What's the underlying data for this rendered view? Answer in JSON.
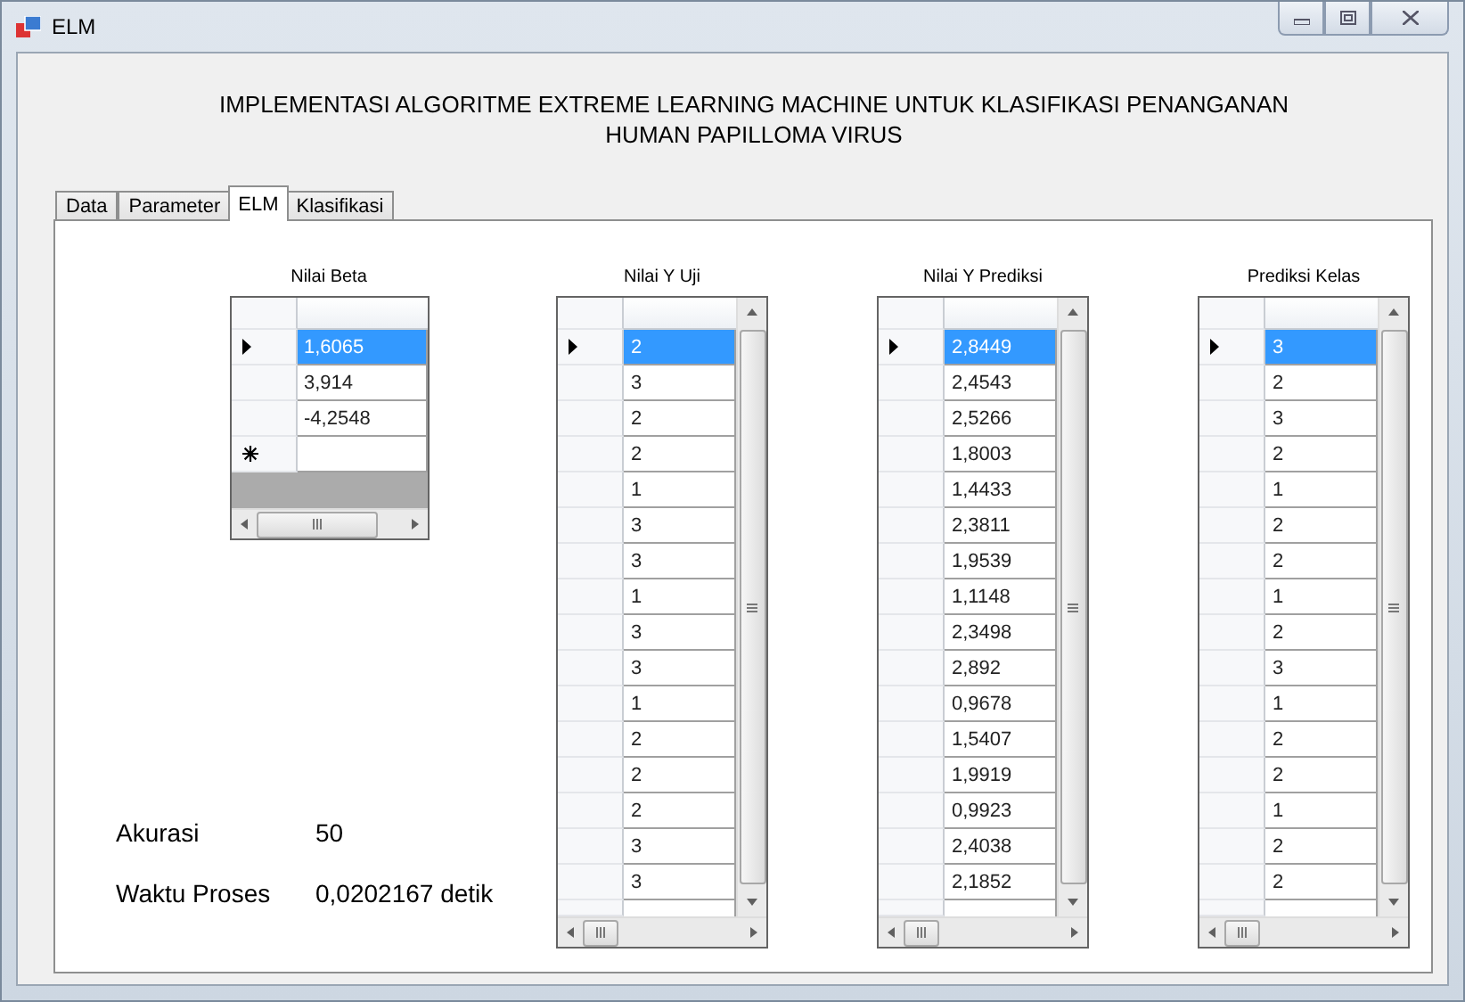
{
  "window": {
    "title": "ELM"
  },
  "heading_lines": [
    "IMPLEMENTASI ALGORITME EXTREME LEARNING MACHINE UNTUK KLASIFIKASI PENANGANAN",
    "HUMAN PAPILLOMA VIRUS"
  ],
  "tabs": [
    {
      "label": "Data",
      "selected": false
    },
    {
      "label": "Parameter",
      "selected": false
    },
    {
      "label": "ELM",
      "selected": true
    },
    {
      "label": "Klasifikasi",
      "selected": false
    }
  ],
  "results": [
    {
      "label": "Akurasi",
      "value": "50"
    },
    {
      "label": "Waktu Proses",
      "value": "0,0202167 detik"
    }
  ],
  "grids": [
    {
      "title": "Nilai Beta",
      "kind": "short",
      "new_row": true,
      "rows": [
        {
          "value": "1,6065",
          "selected": true
        },
        {
          "value": "3,914",
          "selected": false
        },
        {
          "value": "-4,2548",
          "selected": false
        }
      ]
    },
    {
      "title": "Nilai Y Uji",
      "kind": "scroll",
      "rows": [
        {
          "value": "2",
          "selected": true
        },
        {
          "value": "3",
          "selected": false
        },
        {
          "value": "2",
          "selected": false
        },
        {
          "value": "2",
          "selected": false
        },
        {
          "value": "1",
          "selected": false
        },
        {
          "value": "3",
          "selected": false
        },
        {
          "value": "3",
          "selected": false
        },
        {
          "value": "1",
          "selected": false
        },
        {
          "value": "3",
          "selected": false
        },
        {
          "value": "3",
          "selected": false
        },
        {
          "value": "1",
          "selected": false
        },
        {
          "value": "2",
          "selected": false
        },
        {
          "value": "2",
          "selected": false
        },
        {
          "value": "2",
          "selected": false
        },
        {
          "value": "3",
          "selected": false
        },
        {
          "value": "3",
          "selected": false
        }
      ]
    },
    {
      "title": "Nilai Y Prediksi",
      "kind": "scroll",
      "rows": [
        {
          "value": "2,8449",
          "selected": true
        },
        {
          "value": "2,4543",
          "selected": false
        },
        {
          "value": "2,5266",
          "selected": false
        },
        {
          "value": "1,8003",
          "selected": false
        },
        {
          "value": "1,4433",
          "selected": false
        },
        {
          "value": "2,3811",
          "selected": false
        },
        {
          "value": "1,9539",
          "selected": false
        },
        {
          "value": "1,1148",
          "selected": false
        },
        {
          "value": "2,3498",
          "selected": false
        },
        {
          "value": "2,892",
          "selected": false
        },
        {
          "value": "0,9678",
          "selected": false
        },
        {
          "value": "1,5407",
          "selected": false
        },
        {
          "value": "1,9919",
          "selected": false
        },
        {
          "value": "0,9923",
          "selected": false
        },
        {
          "value": "2,4038",
          "selected": false
        },
        {
          "value": "2,1852",
          "selected": false
        }
      ]
    },
    {
      "title": "Prediksi Kelas",
      "kind": "scroll",
      "rows": [
        {
          "value": "3",
          "selected": true
        },
        {
          "value": "2",
          "selected": false
        },
        {
          "value": "3",
          "selected": false
        },
        {
          "value": "2",
          "selected": false
        },
        {
          "value": "1",
          "selected": false
        },
        {
          "value": "2",
          "selected": false
        },
        {
          "value": "2",
          "selected": false
        },
        {
          "value": "1",
          "selected": false
        },
        {
          "value": "2",
          "selected": false
        },
        {
          "value": "3",
          "selected": false
        },
        {
          "value": "1",
          "selected": false
        },
        {
          "value": "2",
          "selected": false
        },
        {
          "value": "2",
          "selected": false
        },
        {
          "value": "1",
          "selected": false
        },
        {
          "value": "2",
          "selected": false
        },
        {
          "value": "2",
          "selected": false
        }
      ]
    }
  ]
}
